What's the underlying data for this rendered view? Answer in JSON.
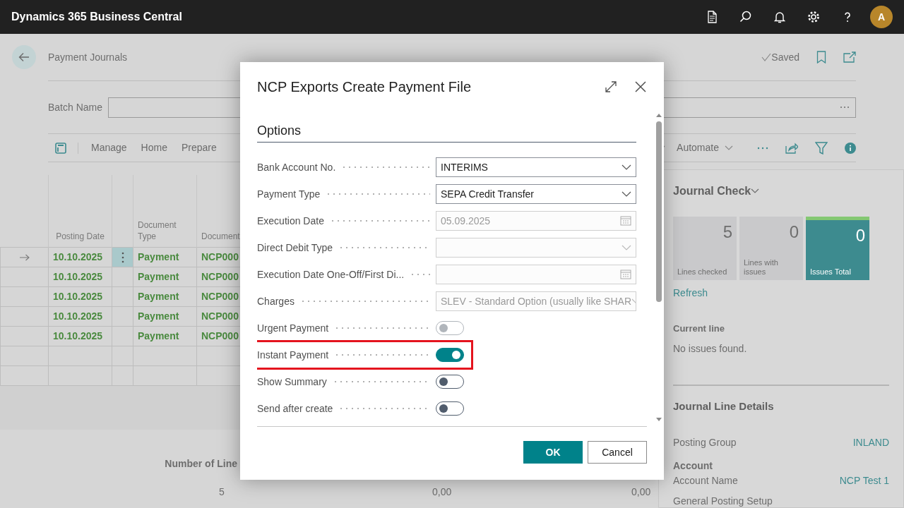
{
  "app": {
    "title": "Dynamics 365 Business Central",
    "avatar": "A"
  },
  "page": {
    "title": "Payment Journals",
    "save_status": "Saved",
    "batch_label": "Batch Name",
    "actions": [
      "Manage",
      "Home",
      "Prepare"
    ],
    "automate": "Automate"
  },
  "journal": {
    "columns": [
      "Posting Date",
      "Document Type",
      "Document"
    ],
    "rows": [
      {
        "kind": "entry",
        "posting_date": "10.10.2025",
        "document_type": "Payment",
        "document_no": "NCP000",
        "selected": true
      },
      {
        "kind": "entry",
        "posting_date": "10.10.2025",
        "document_type": "Payment",
        "document_no": "NCP000",
        "selected": false
      },
      {
        "kind": "entry",
        "posting_date": "10.10.2025",
        "document_type": "Payment",
        "document_no": "NCP000",
        "selected": false
      },
      {
        "kind": "entry",
        "posting_date": "10.10.2025",
        "document_type": "Payment",
        "document_no": "NCP000",
        "selected": false
      },
      {
        "kind": "entry",
        "posting_date": "10.10.2025",
        "document_type": "Payment",
        "document_no": "NCP000",
        "selected": false
      },
      {
        "kind": "blank"
      },
      {
        "kind": "blank"
      }
    ]
  },
  "totals": {
    "label": "Number of Line",
    "count": "5",
    "amounts": [
      "0,00",
      "0,00"
    ]
  },
  "factbox": {
    "title": "Journal Check",
    "tiles": [
      {
        "value": "5",
        "label": "Lines checked",
        "highlighted": false
      },
      {
        "value": "0",
        "label": "Lines with issues",
        "highlighted": false
      },
      {
        "value": "0",
        "label": "Issues Total",
        "highlighted": true
      }
    ],
    "refresh": "Refresh",
    "current_line_title": "Current line",
    "current_line_text": "No issues found.",
    "details_title": "Journal Line Details",
    "details": [
      {
        "kind": "pair",
        "label": "Posting Group",
        "value": "INLAND"
      },
      {
        "kind": "heading",
        "label": "Account"
      },
      {
        "kind": "pair",
        "label": "Account Name",
        "value": "NCP Test 1"
      },
      {
        "kind": "label",
        "label": "General Posting Setup"
      }
    ]
  },
  "dialog": {
    "title": "NCP Exports Create Payment File",
    "section": "Options",
    "fields": [
      {
        "kind": "select",
        "label": "Bank Account No.",
        "value": "INTERIMS",
        "disabled": false
      },
      {
        "kind": "select",
        "label": "Payment Type",
        "value": "SEPA Credit Transfer",
        "disabled": false
      },
      {
        "kind": "date",
        "label": "Execution Date",
        "value": "05.09.2025",
        "disabled": true
      },
      {
        "kind": "select",
        "label": "Direct Debit Type",
        "disabled": true
      },
      {
        "kind": "date",
        "label": "Execution Date One-Off/First Di...",
        "disabled": true
      },
      {
        "kind": "select",
        "label": "Charges",
        "value": "SLEV - Standard Option (usually like SHAR",
        "disabled": true
      },
      {
        "kind": "toggle",
        "label": "Urgent Payment",
        "on": false,
        "disabled": true,
        "highlighted": false
      },
      {
        "kind": "toggle",
        "label": "Instant Payment",
        "on": true,
        "disabled": false,
        "highlighted": true
      },
      {
        "kind": "toggle",
        "label": "Show Summary",
        "on": false,
        "disabled": false,
        "highlighted": false
      },
      {
        "kind": "toggle",
        "label": "Send after create",
        "on": false,
        "disabled": false,
        "highlighted": false
      }
    ],
    "buttons": [
      {
        "label": "OK",
        "primary": true
      },
      {
        "label": "Cancel",
        "primary": false
      }
    ]
  }
}
